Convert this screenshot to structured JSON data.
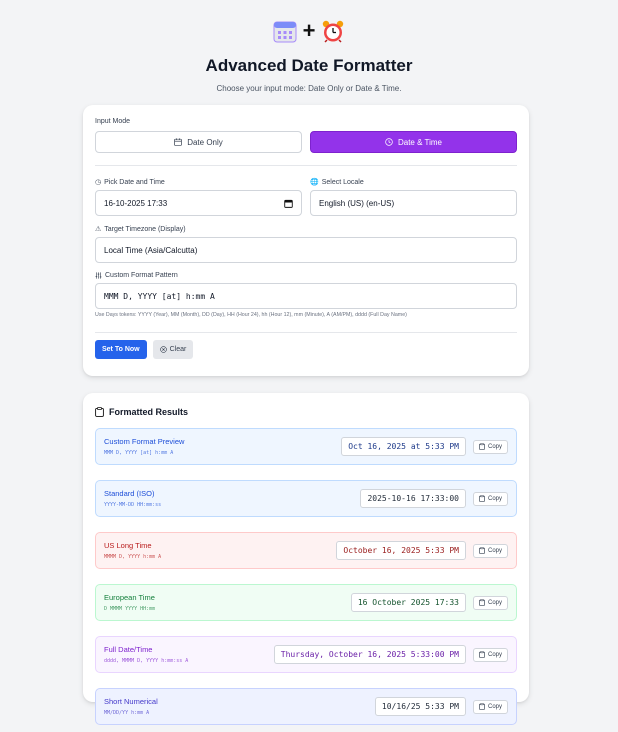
{
  "header": {
    "title": "Advanced Date Formatter",
    "subtitle": "Choose your input mode: Date Only or Date & Time.",
    "plus": "+"
  },
  "input": {
    "mode_label": "Input Mode",
    "mode_date_only": "Date Only",
    "mode_date_time": "Date & Time",
    "active_mode": "Date & Time",
    "date_time_label": "Pick Date and Time",
    "date_time_value": "16-10-2025 17:33",
    "locale_label": "Select Locale",
    "locale_value": "English (US) (en-US)",
    "timezone_label": "Target Timezone (Display)",
    "timezone_value": "Local Time (Asia/Calcutta)",
    "pattern_label": "Custom Format Pattern",
    "pattern_value": "MMM D, YYYY [at] h:mm A",
    "hint": "Use Days tokens: YYYY (Year), MM (Month), DD (Day), HH (Hour 24), hh (Hour 12), mm (Minute), A (AM/PM), dddd (Full Day Name)",
    "set_now": "Set To Now",
    "clear": "Clear"
  },
  "results": {
    "title": "Formatted Results",
    "copy_label": "Copy",
    "items": [
      {
        "name": "Custom Format Preview",
        "pattern": "MMM D, YYYY [at] h:mm A",
        "value": "Oct 16, 2025 at 5:33 PM",
        "bg": "#eff6ff",
        "border": "#bfdbfe",
        "text": "#1d4ed8",
        "value_color": "#1e3a8a"
      },
      {
        "name": "Standard (ISO)",
        "pattern": "YYYY-MM-DD HH:mm:ss",
        "value": "2025-10-16 17:33:00",
        "bg": "#eff6ff",
        "border": "#bfdbfe",
        "text": "#1d4ed8",
        "value_color": "#1f2937"
      },
      {
        "name": "US Long Time",
        "pattern": "MMMM D, YYYY h:mm A",
        "value": "October 16, 2025 5:33 PM",
        "bg": "#fef2f2",
        "border": "#fecaca",
        "text": "#b91c1c",
        "value_color": "#991b1b"
      },
      {
        "name": "European Time",
        "pattern": "D MMMM YYYY HH:mm",
        "value": "16 October 2025 17:33",
        "bg": "#f0fdf4",
        "border": "#bbf7d0",
        "text": "#15803d",
        "value_color": "#14532d"
      },
      {
        "name": "Full Date/Time",
        "pattern": "dddd, MMMM D, YYYY h:mm:ss A",
        "value": "Thursday, October 16, 2025 5:33:00 PM",
        "bg": "#faf5ff",
        "border": "#e9d5ff",
        "text": "#7e22ce",
        "value_color": "#6b21a8"
      },
      {
        "name": "Short Numerical",
        "pattern": "MM/DD/YY h:mm A",
        "value": "10/16/25 5:33 PM",
        "bg": "#eef2ff",
        "border": "#c7d2fe",
        "text": "#4338ca",
        "value_color": "#1f2937"
      }
    ]
  },
  "colors": {
    "accent_purple": "#9333ea",
    "accent_blue": "#2563eb"
  },
  "icons": [
    "calendar-icon",
    "alarm-clock-icon",
    "clock-icon",
    "globe-icon",
    "warning-icon",
    "sliders-icon",
    "clipboard-icon",
    "x-circle-icon"
  ]
}
